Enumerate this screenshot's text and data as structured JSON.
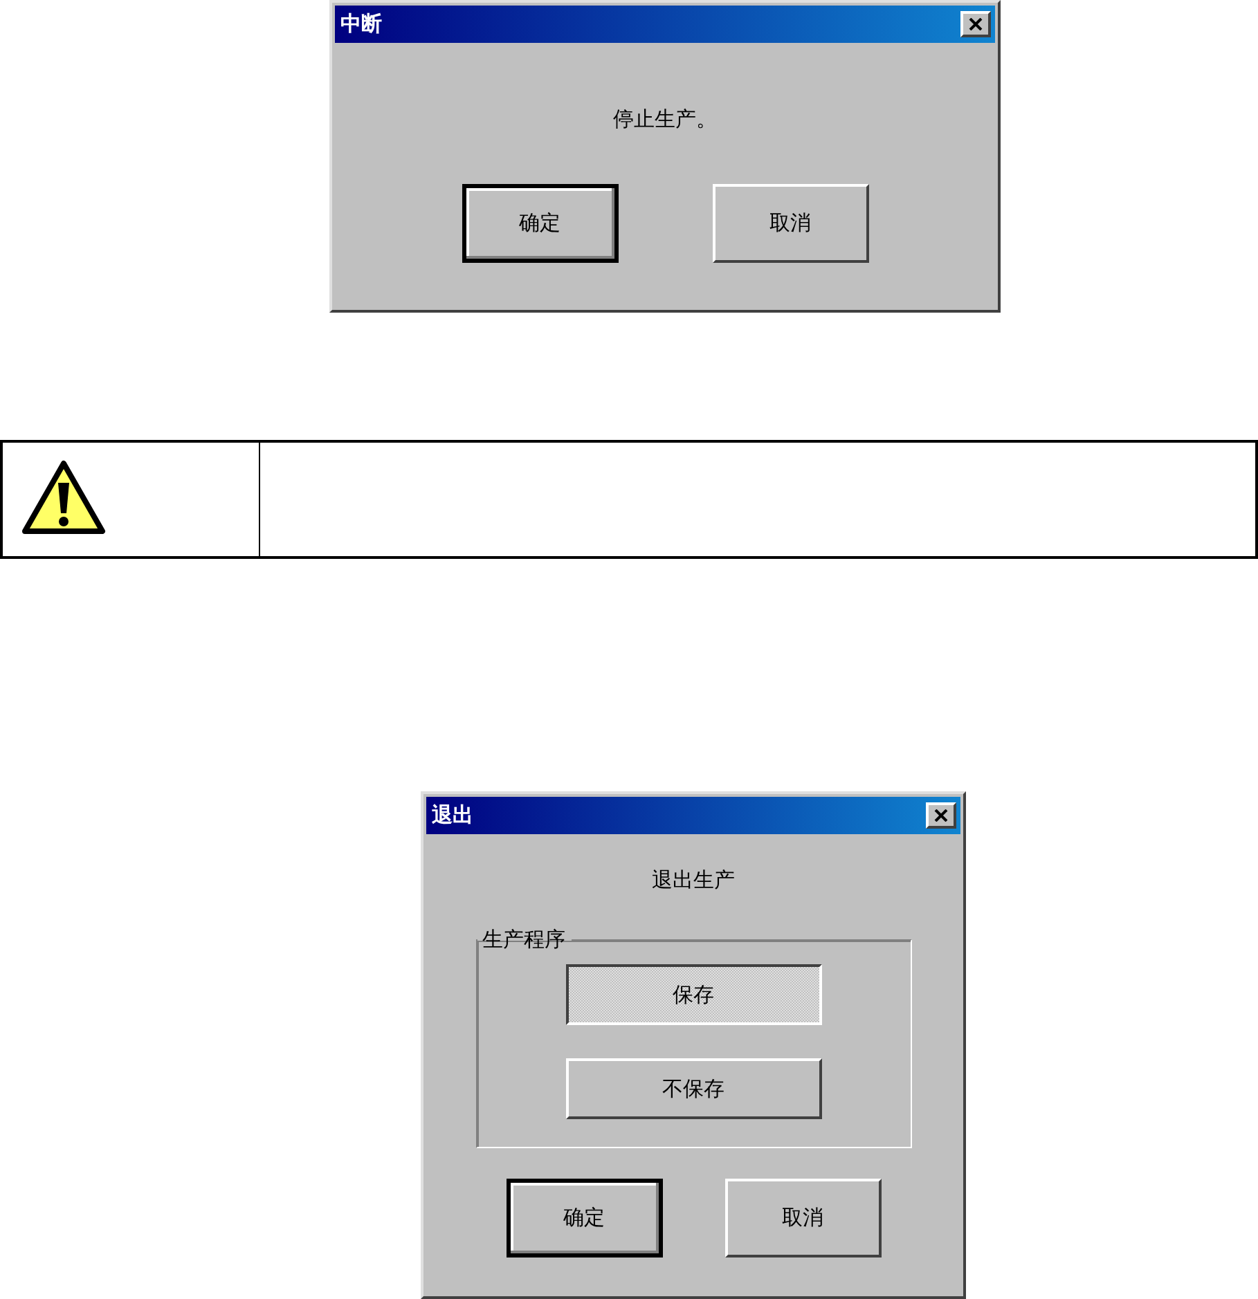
{
  "dialogs": [
    {
      "title": "中断",
      "message": "停止生产。",
      "buttons": [
        {
          "label": "确定",
          "default": true
        },
        {
          "label": "取消",
          "default": false
        }
      ]
    },
    {
      "title": "退出",
      "message": "退出生产",
      "group": {
        "label": "生产程序",
        "options": [
          {
            "label": "保存",
            "selected": true
          },
          {
            "label": "不保存",
            "selected": false
          }
        ]
      },
      "buttons": [
        {
          "label": "确定",
          "default": true
        },
        {
          "label": "取消",
          "default": false
        }
      ]
    }
  ],
  "warning": {
    "kind": "caution"
  }
}
